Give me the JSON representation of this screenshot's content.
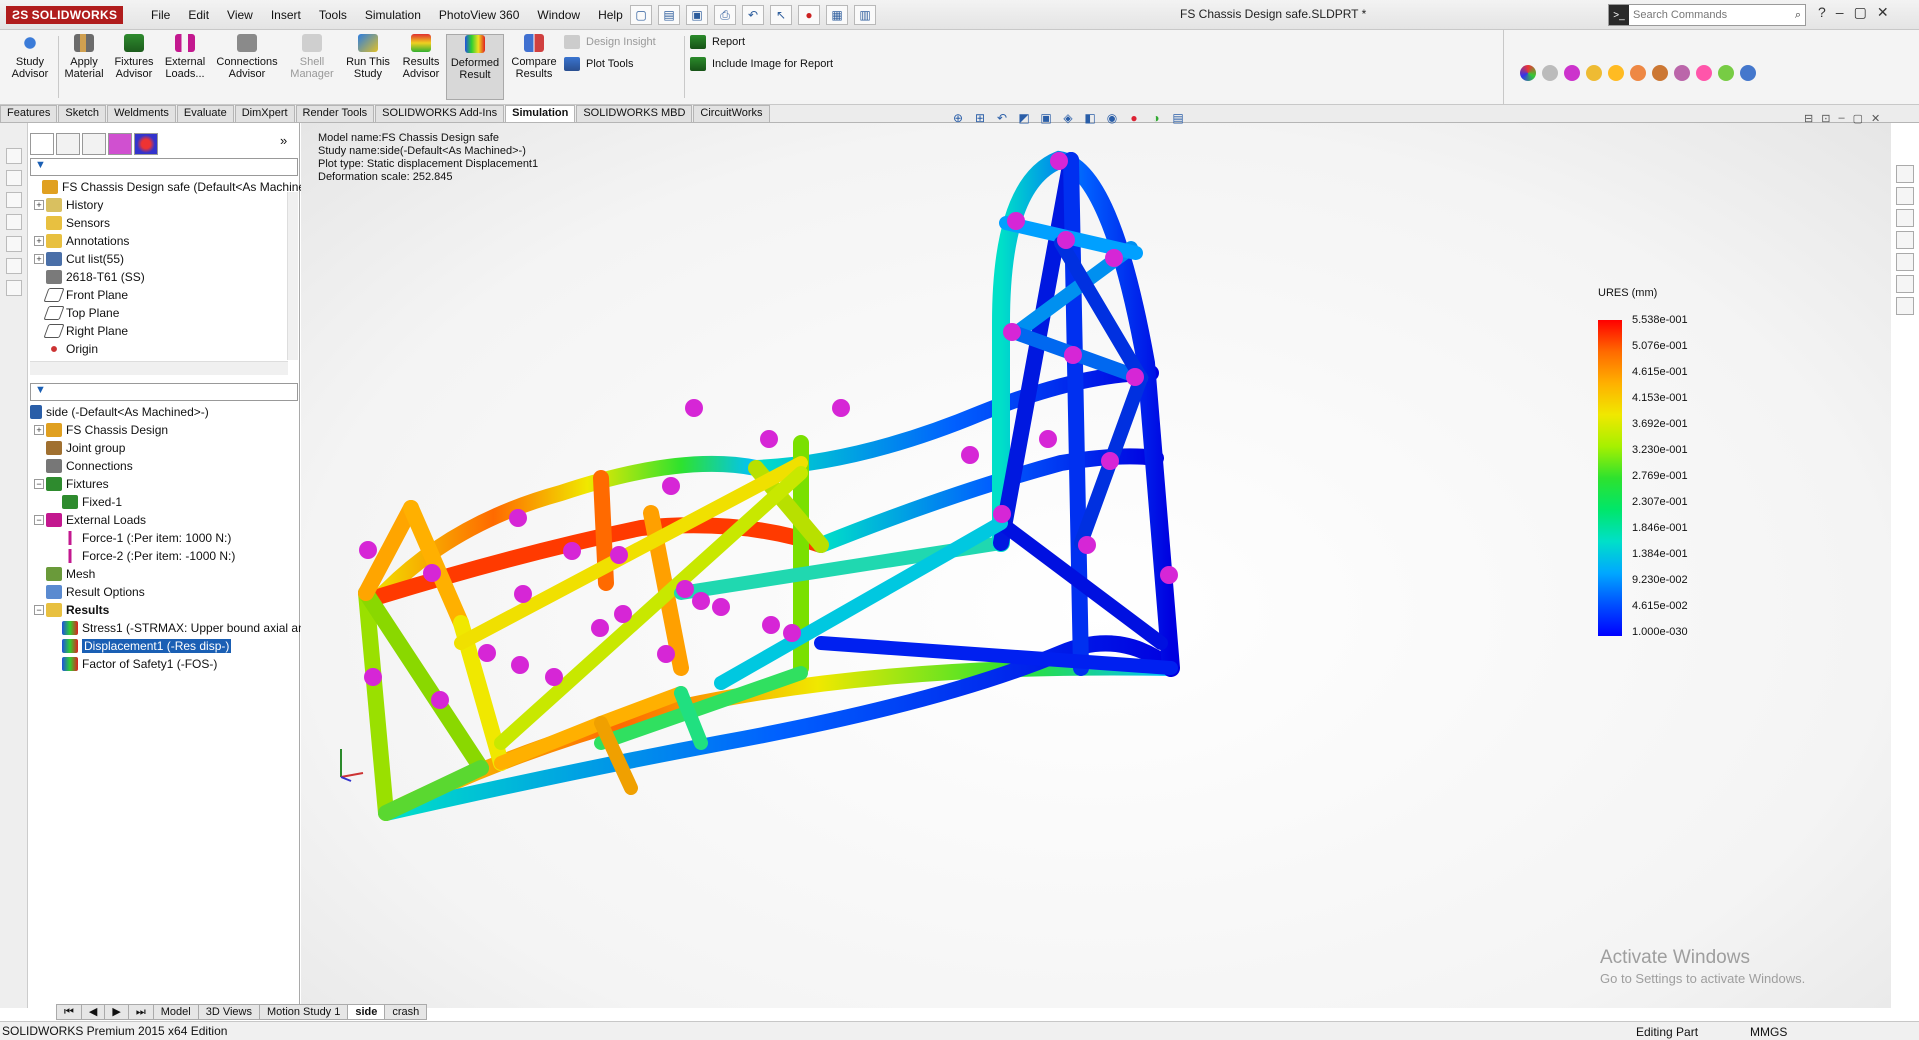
{
  "app": {
    "brand": "SOLIDWORKS",
    "document_title": "FS Chassis Design safe.SLDPRT *"
  },
  "menu": [
    "File",
    "Edit",
    "View",
    "Insert",
    "Tools",
    "Simulation",
    "PhotoView 360",
    "Window",
    "Help"
  ],
  "search": {
    "placeholder": "Search Commands"
  },
  "command_manager": {
    "buttons": [
      {
        "label": "Study Advisor"
      },
      {
        "label": "Apply Material"
      },
      {
        "label": "Fixtures Advisor"
      },
      {
        "label": "External Loads..."
      },
      {
        "label": "Connections Advisor"
      },
      {
        "label": "Shell Manager"
      },
      {
        "label": "Run This Study"
      },
      {
        "label": "Results Advisor"
      },
      {
        "label": "Deformed Result"
      },
      {
        "label": "Compare Results"
      }
    ],
    "small": [
      {
        "label": "Design Insight"
      },
      {
        "label": "Plot Tools"
      },
      {
        "label": "Report"
      },
      {
        "label": "Include Image for Report"
      }
    ]
  },
  "tabs": [
    "Features",
    "Sketch",
    "Weldments",
    "Evaluate",
    "DimXpert",
    "Render Tools",
    "SOLIDWORKS Add-Ins",
    "Simulation",
    "SOLIDWORKS MBD",
    "CircuitWorks"
  ],
  "feature_tree": {
    "root": "FS Chassis Design safe  (Default<As Machine",
    "items": [
      "History",
      "Sensors",
      "Annotations",
      "Cut list(55)",
      "2618-T61 (SS)",
      "Front Plane",
      "Top Plane",
      "Right Plane",
      "Origin"
    ]
  },
  "study_tree": {
    "root": "side (-Default<As Machined>-)",
    "items": [
      "FS Chassis Design",
      "Joint group",
      "Connections",
      "Fixtures",
      "Fixed-1",
      "External Loads",
      "Force-1 (:Per item: 1000 N:)",
      "Force-2 (:Per item: -1000 N:)",
      "Mesh",
      "Result Options",
      "Results",
      "Stress1 (-STRMAX: Upper bound axial an",
      "Displacement1 (-Res disp-)",
      "Factor of Safety1 (-FOS-)"
    ]
  },
  "plot_info": {
    "model_name": "Model name:FS Chassis Design safe",
    "study_name": "Study name:side(-Default<As Machined>-)",
    "plot_type": "Plot type: Static displacement Displacement1",
    "deformation_scale": "Deformation scale: 252.845"
  },
  "legend": {
    "title": "URES (mm)",
    "values": [
      "5.538e-001",
      "5.076e-001",
      "4.615e-001",
      "4.153e-001",
      "3.692e-001",
      "3.230e-001",
      "2.769e-001",
      "2.307e-001",
      "1.846e-001",
      "1.384e-001",
      "9.230e-002",
      "4.615e-002",
      "1.000e-030"
    ]
  },
  "watermark": {
    "line1": "Activate Windows",
    "line2": "Go to Settings to activate Windows."
  },
  "sheet_tabs": [
    "Model",
    "3D Views",
    "Motion Study 1",
    "side",
    "crash"
  ],
  "status": {
    "edition": "SOLIDWORKS Premium 2015 x64 Edition",
    "mode": "Editing Part",
    "units": "MMGS"
  }
}
